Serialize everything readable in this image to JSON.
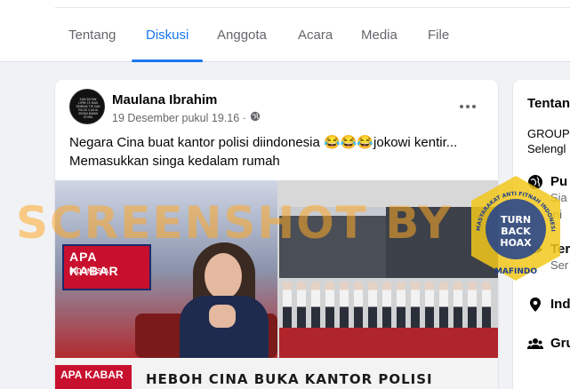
{
  "tabs": [
    {
      "label": "Tentang",
      "active": false
    },
    {
      "label": "Diskusi",
      "active": true
    },
    {
      "label": "Anggota",
      "active": false
    },
    {
      "label": "Acara",
      "active": false
    },
    {
      "label": "Media",
      "active": false
    },
    {
      "label": "File",
      "active": false
    }
  ],
  "post": {
    "author": "Maulana Ibrahim",
    "timestamp": "19 Desember pukul 19.16 ·",
    "text_line1": "Negara Cina buat kantor polisi diindonesia 😂😂😂jokowi kentir...",
    "text_line2": "Memasukkan singa kedalam rumah",
    "avatar_text": "ZAM BUTAN LIPPA TE MAN SEMBAK TIR SAN POLISI 4 JULIA SNTAN BANIN STURA"
  },
  "media": {
    "logo_title": "APA KABAR",
    "logo_sub": "INDONESIA",
    "ticker_logo": "APA KABAR",
    "ticker_text": "HEBOH CINA BUKA KANTOR POLISI"
  },
  "sidebar": {
    "title": "Tentan",
    "line1": "GROUP",
    "line2": "Selengl",
    "rows": [
      {
        "icon": "globe-icon",
        "label": "Pu",
        "sub1": "Sia",
        "sub2": "ini"
      },
      {
        "icon": "eye-icon",
        "label": "Ter",
        "sub1": "Ser"
      },
      {
        "icon": "location-pin-icon",
        "label": "Ind"
      },
      {
        "icon": "group-icon",
        "label": "Gru"
      }
    ]
  },
  "overlay": {
    "watermark": "SCREENSHOT BY",
    "badge_line1": "TURN",
    "badge_line2": "BACK",
    "badge_line3": "HOAX",
    "badge_arc": "MASYARAKAT ANTI FITNAH INDONESIA",
    "badge_org": "MAFINDO"
  },
  "colors": {
    "accent": "#1877f2",
    "watermark": "#ffaa28",
    "badge_yellow": "#f2c81c",
    "badge_blue": "#1f3f8f"
  }
}
